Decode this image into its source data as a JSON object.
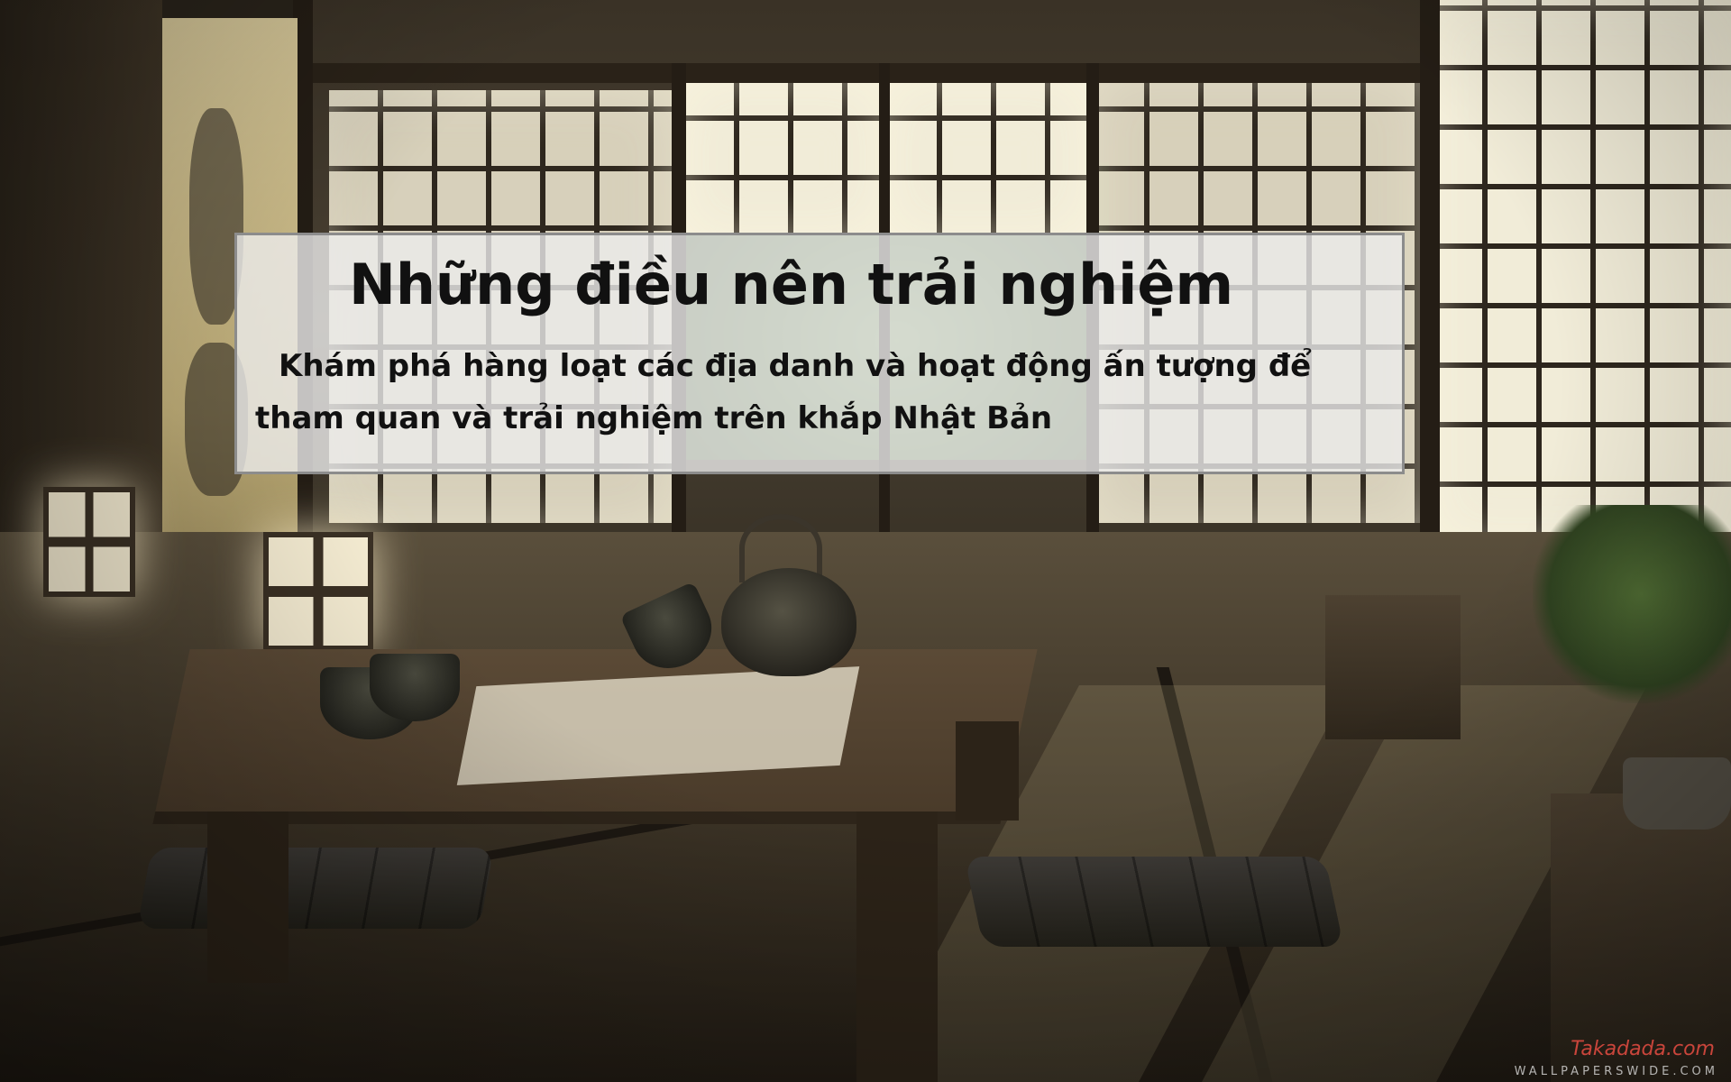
{
  "overlay": {
    "title": "Những điều nên trải nghiệm",
    "description": "Khám phá hàng loạt các địa danh và hoạt động ấn tượng để tham quan và trải nghiệm trên khắp Nhật Bản"
  },
  "watermarks": {
    "site": "Takadada.com",
    "wallpaper": "WALLPAPERSWIDE.COM"
  },
  "colors": {
    "overlay_bg": "#ececec",
    "text": "#111111",
    "site_watermark": "#c9453b"
  }
}
